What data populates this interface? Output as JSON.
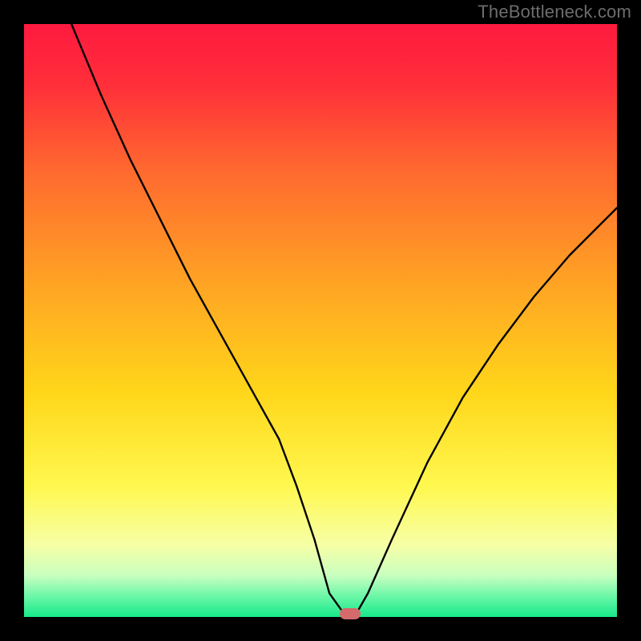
{
  "watermark": "TheBottleneck.com",
  "chart_data": {
    "type": "line",
    "title": "",
    "xlabel": "",
    "ylabel": "",
    "xlim": [
      0,
      100
    ],
    "ylim": [
      0,
      100
    ],
    "grid": false,
    "series": [
      {
        "name": "bottleneck-curve",
        "x": [
          8,
          13,
          18,
          23,
          28,
          33,
          38,
          43,
          46,
          49,
          51.5,
          54,
          56,
          58,
          62,
          68,
          74,
          80,
          86,
          92,
          98,
          100
        ],
        "values": [
          100,
          88,
          77,
          67,
          57,
          48,
          39,
          30,
          22,
          13,
          4,
          0.5,
          0.5,
          4,
          13,
          26,
          37,
          46,
          54,
          61,
          67,
          69
        ]
      }
    ],
    "gradient_stops": [
      {
        "offset": 0.0,
        "color": "#ff1a3f"
      },
      {
        "offset": 0.1,
        "color": "#ff2e3a"
      },
      {
        "offset": 0.25,
        "color": "#ff6a2f"
      },
      {
        "offset": 0.45,
        "color": "#ffa723"
      },
      {
        "offset": 0.62,
        "color": "#ffd61a"
      },
      {
        "offset": 0.78,
        "color": "#fff84f"
      },
      {
        "offset": 0.88,
        "color": "#f6ffa7"
      },
      {
        "offset": 0.93,
        "color": "#c9ffbf"
      },
      {
        "offset": 0.965,
        "color": "#6bf7a8"
      },
      {
        "offset": 1.0,
        "color": "#17e98a"
      }
    ],
    "marker": {
      "x": 55,
      "y": 0.5,
      "color": "#d46a6b"
    },
    "line_color": "#000000",
    "line_width": 2.4
  }
}
